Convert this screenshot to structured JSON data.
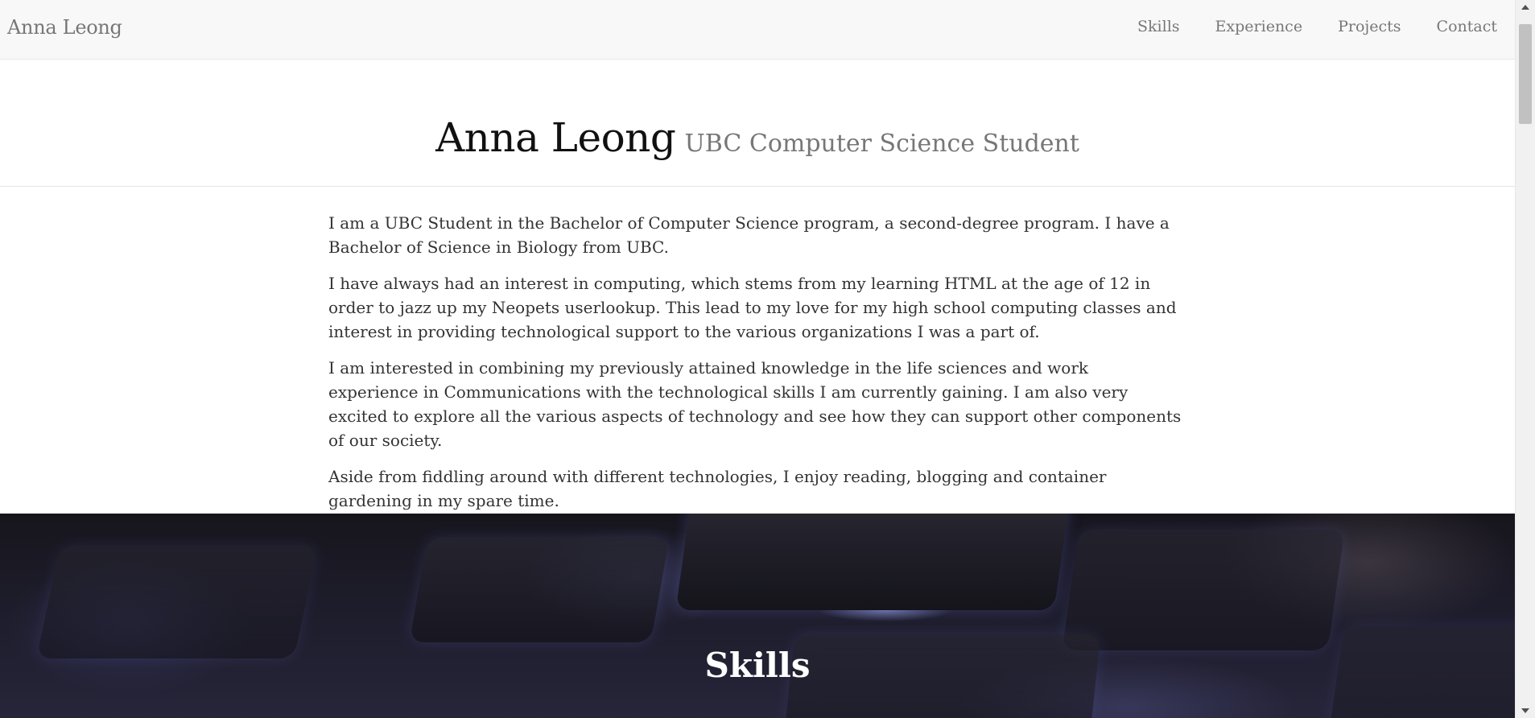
{
  "navbar": {
    "brand": "Anna Leong",
    "items": [
      {
        "label": "Skills"
      },
      {
        "label": "Experience"
      },
      {
        "label": "Projects"
      },
      {
        "label": "Contact"
      }
    ]
  },
  "header": {
    "name": "Anna Leong",
    "subtitle": "UBC Computer Science Student"
  },
  "about": {
    "paragraphs": [
      "I am a UBC Student in the Bachelor of Computer Science program, a second-degree program. I have a Bachelor of Science in Biology from UBC.",
      "I have always had an interest in computing, which stems from my learning HTML at the age of 12 in order to jazz up my Neopets userlookup. This lead to my love for my high school computing classes and interest in providing technological support to the various organizations I was a part of.",
      "I am interested in combining my previously attained knowledge in the life sciences and work experience in Communications with the technological skills I am currently gaining. I am also very excited to explore all the various aspects of technology and see how they can support other components of our society.",
      "Aside from fiddling around with different technologies, I enjoy reading, blogging and container gardening in my spare time."
    ]
  },
  "skills_banner": {
    "title": "Skills"
  },
  "colors": {
    "navbar_bg": "#f8f8f8",
    "nav_text": "#777777",
    "heading": "#111111",
    "body_text": "#333333"
  }
}
